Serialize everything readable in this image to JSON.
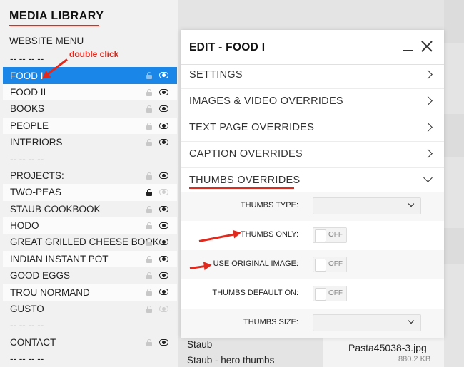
{
  "sidebar": {
    "title": "MEDIA LIBRARY",
    "website_menu": "WEBSITE MENU",
    "items": [
      {
        "label": "-- -- -- --",
        "type": "separator"
      },
      {
        "label": "FOOD I",
        "selected": true,
        "lock": "light",
        "eye": "visible"
      },
      {
        "label": "FOOD II",
        "lock": "light",
        "eye": "visible"
      },
      {
        "label": "BOOKS",
        "lock": "light",
        "eye": "visible"
      },
      {
        "label": "PEOPLE",
        "lock": "light",
        "eye": "visible"
      },
      {
        "label": "INTERIORS",
        "lock": "light",
        "eye": "visible"
      },
      {
        "label": "-- -- -- --",
        "type": "separator"
      },
      {
        "label": "PROJECTS:",
        "lock": "light",
        "eye": "visible"
      },
      {
        "label": "TWO-PEAS",
        "lock": "dark",
        "eye": "hidden"
      },
      {
        "label": "STAUB COOKBOOK",
        "lock": "light",
        "eye": "visible"
      },
      {
        "label": "HODO",
        "lock": "light",
        "eye": "visible"
      },
      {
        "label": "GREAT GRILLED CHEESE BOOK",
        "lock": "light",
        "eye": "visible"
      },
      {
        "label": "INDIAN INSTANT POT",
        "lock": "light",
        "eye": "visible"
      },
      {
        "label": "GOOD EGGS",
        "lock": "light",
        "eye": "visible"
      },
      {
        "label": "TROU NORMAND",
        "lock": "light",
        "eye": "visible"
      },
      {
        "label": "GUSTO",
        "lock": "light",
        "eye": "hidden"
      },
      {
        "label": "-- -- -- --",
        "type": "separator"
      },
      {
        "label": "CONTACT",
        "lock": "light",
        "eye": "visible"
      },
      {
        "label": "-- -- -- --",
        "type": "separator"
      }
    ]
  },
  "annotation": {
    "text": "double click",
    "color": "#e1291d"
  },
  "background": {
    "rows": [
      "Staub",
      "Staub - hero thumbs"
    ],
    "file_name": "Pasta45038-3.jpg",
    "file_size": "880.2 KB"
  },
  "panel": {
    "title": "EDIT - FOOD I",
    "sections": [
      {
        "label": "SETTINGS",
        "icon": "chevron-right-icon"
      },
      {
        "label": "IMAGES & VIDEO OVERRIDES",
        "icon": "chevron-right-icon"
      },
      {
        "label": "TEXT PAGE OVERRIDES",
        "icon": "chevron-right-icon"
      },
      {
        "label": "CAPTION OVERRIDES",
        "icon": "chevron-right-icon"
      },
      {
        "label": "THUMBS OVERRIDES",
        "icon": "chevron-down-icon",
        "expanded": true
      }
    ],
    "thumbs": {
      "type_label": "THUMBS TYPE:",
      "type_value": "",
      "only_label": "THUMBS ONLY:",
      "only_state": "OFF",
      "original_label": "USE ORIGINAL IMAGE:",
      "original_state": "OFF",
      "default_label": "THUMBS DEFAULT ON:",
      "default_state": "OFF",
      "size_label": "THUMBS SIZE:",
      "size_value": ""
    }
  },
  "colors": {
    "accent": "#1a86e8",
    "annotation": "#e1291d"
  }
}
